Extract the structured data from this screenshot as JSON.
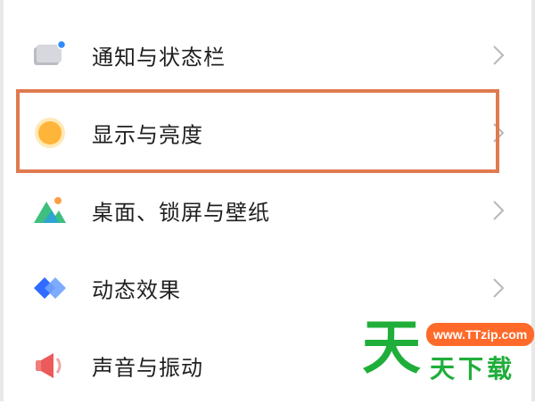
{
  "settings_list": [
    {
      "label": "通知与状态栏",
      "icon": "notification-icon"
    },
    {
      "label": "显示与亮度",
      "icon": "brightness-icon"
    },
    {
      "label": "桌面、锁屏与壁纸",
      "icon": "wallpaper-icon"
    },
    {
      "label": "动态效果",
      "icon": "animation-icon"
    },
    {
      "label": "声音与振动",
      "icon": "sound-icon"
    }
  ],
  "highlight": {
    "color": "#e07a4f",
    "target": "显示与亮度"
  },
  "watermark": {
    "url": "www.TTzip.com",
    "big_char": "天",
    "text": "天下载",
    "brand_color": "#1fae3a",
    "url_color": "#ff6a2a"
  },
  "colors": {
    "chevron": "#b8b8b8",
    "text": "#1f1f1f"
  }
}
